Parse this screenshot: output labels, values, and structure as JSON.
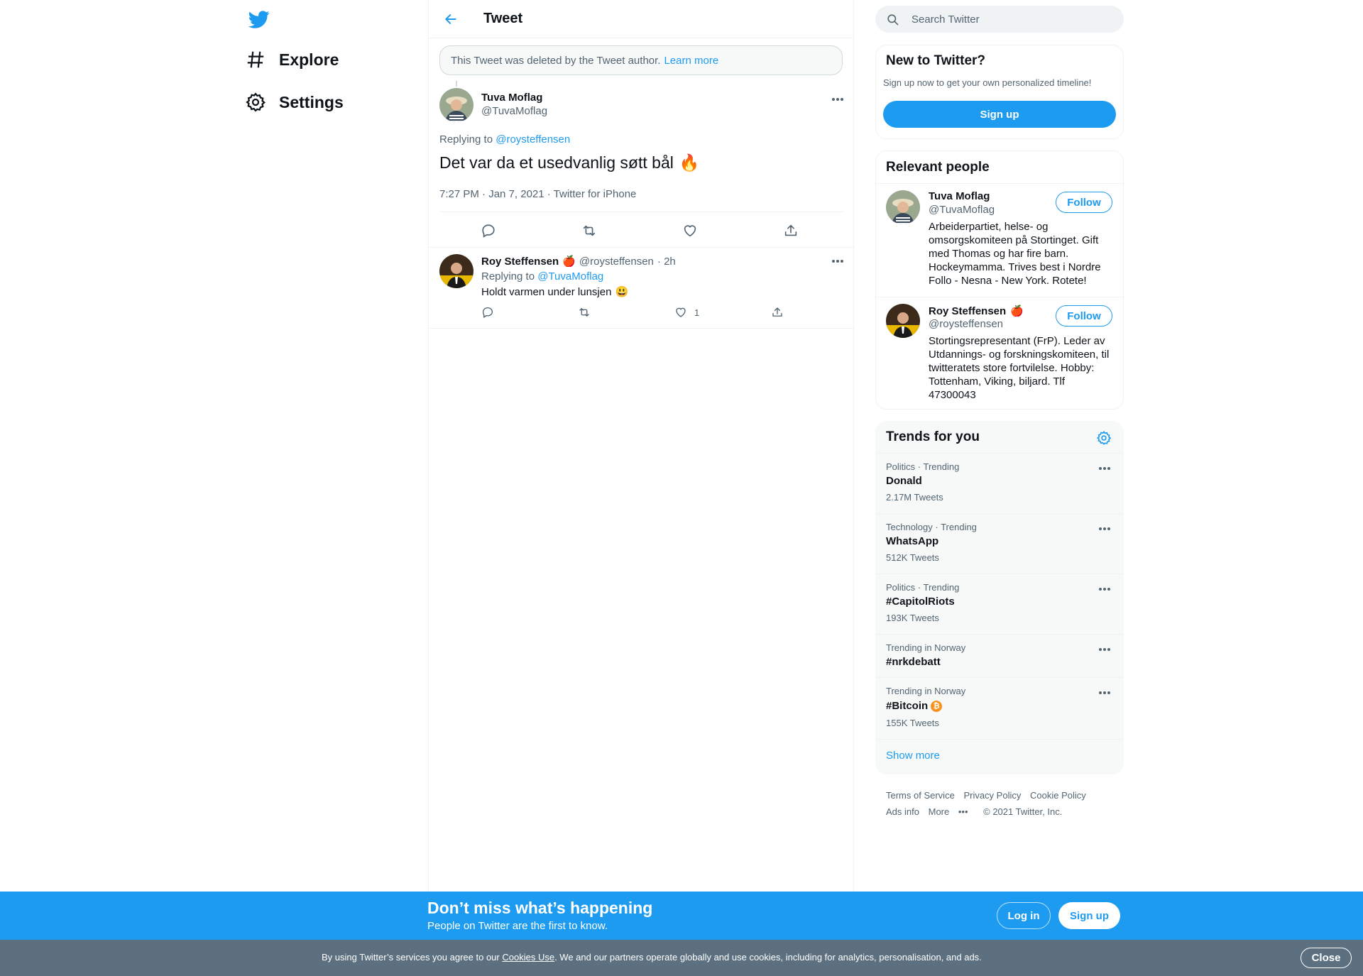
{
  "nav": {
    "explore": "Explore",
    "settings": "Settings"
  },
  "header": {
    "title": "Tweet"
  },
  "deleted_notice": {
    "text": "This Tweet was deleted by the Tweet author.",
    "link": "Learn more"
  },
  "tweet": {
    "name": "Tuva Moflag",
    "handle": "@TuvaMoflag",
    "replying_label": "Replying to",
    "replying_to": "@roysteffensen",
    "text": "Det var da et usedvanlig søtt bål",
    "emoji": "🔥",
    "time": "7:27 PM · Jan 7, 2021",
    "source": "Twitter for iPhone"
  },
  "reply": {
    "name": "Roy Steffensen",
    "badge": "🍎",
    "handle": "@roysteffensen",
    "time": "· 2h",
    "replying_label": "Replying to",
    "replying_to": "@TuvaMoflag",
    "text": "Holdt varmen under lunsjen",
    "emoji": "😃",
    "likes": "1"
  },
  "search": {
    "placeholder": "Search Twitter"
  },
  "new_to_twitter": {
    "title": "New to Twitter?",
    "subtitle": "Sign up now to get your own personalized timeline!",
    "button": "Sign up"
  },
  "relevant": {
    "title": "Relevant people",
    "people": [
      {
        "name": "Tuva Moflag",
        "badge": "",
        "handle": "@TuvaMoflag",
        "bio": "Arbeiderpartiet, helse- og omsorgskomiteen på Stortinget. Gift med Thomas og har fire barn. Hockeymamma. Trives best i Nordre Follo - Nesna - New York. Rotete!",
        "follow": "Follow"
      },
      {
        "name": "Roy Steffensen",
        "badge": "🍎",
        "handle": "@roysteffensen",
        "bio": "Stortingsrepresentant (FrP). Leder av Utdannings- og forskningskomiteen, til twitteratets store fortvilelse. Hobby: Tottenham, Viking, biljard. Tlf 47300043",
        "follow": "Follow"
      }
    ]
  },
  "trends": {
    "title": "Trends for you",
    "items": [
      {
        "category": "Politics · Trending",
        "name": "Donald",
        "count": "2.17M Tweets"
      },
      {
        "category": "Technology · Trending",
        "name": "WhatsApp",
        "count": "512K Tweets"
      },
      {
        "category": "Politics · Trending",
        "name": "#CapitolRiots",
        "count": "193K Tweets"
      },
      {
        "category": "Trending in Norway",
        "name": "#nrkdebatt",
        "count": ""
      },
      {
        "category": "Trending in Norway",
        "name": "#Bitcoin",
        "emoji": "₿",
        "count": "155K Tweets"
      }
    ],
    "show_more": "Show more"
  },
  "footer": {
    "terms": "Terms of Service",
    "privacy": "Privacy Policy",
    "cookie": "Cookie Policy",
    "ads": "Ads info",
    "more": "More",
    "copyright": "© 2021 Twitter, Inc."
  },
  "banner": {
    "title": "Don’t miss what’s happening",
    "subtitle": "People on Twitter are the first to know.",
    "login": "Log in",
    "signup": "Sign up"
  },
  "cookie_bar": {
    "prefix": "By using Twitter’s services you agree to our",
    "link": "Cookies Use",
    "suffix": ". We and our partners operate globally and use cookies, including for analytics, personalisation, and ads.",
    "close": "Close"
  },
  "colors": {
    "accent": "#1d9bf0",
    "cookie_bar": "#5c7080",
    "trends_bg": "#f7f9f9"
  }
}
